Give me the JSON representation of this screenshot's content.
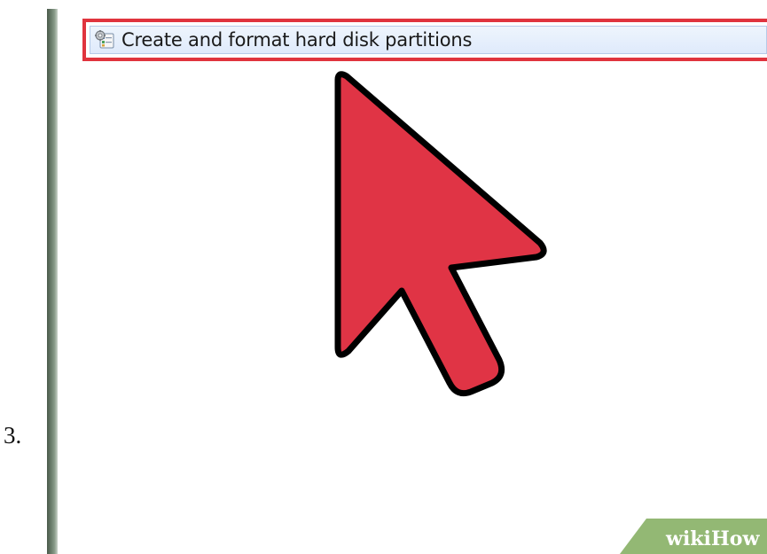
{
  "step": {
    "number": "3."
  },
  "control_panel": {
    "task_link": {
      "label": "Create and format hard disk partitions",
      "icon": "admin-tools-icon"
    },
    "highlight_color": "#e0343e",
    "row_color": "#dfeafb"
  },
  "overlay": {
    "pointer": {
      "icon": "arrow-cursor-icon",
      "fill_color": "#e03445",
      "outline_color": "#000000"
    }
  },
  "watermark": {
    "part1": "wiki",
    "part2": "How"
  }
}
